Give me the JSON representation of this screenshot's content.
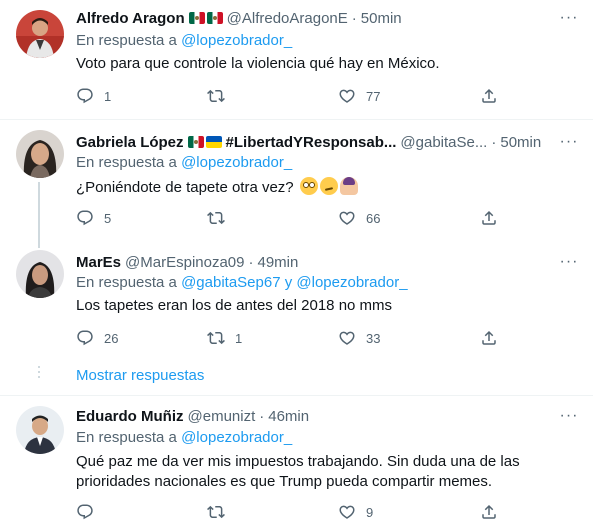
{
  "reply_prefix": "En respuesta a",
  "show_more_replies": "Mostrar respuestas",
  "colors": {
    "link": "#1d9bf0",
    "secondary": "#536471",
    "text": "#0f1419",
    "thread_line": "#cfd9de"
  },
  "tweets": [
    {
      "name": "Alfredo Aragon",
      "flags": [
        "mx-flag",
        "mx-flag"
      ],
      "handle": "@AlfredoAragonE",
      "time": "50min",
      "reply_to": [
        "@lopezobrador_"
      ],
      "text": "Voto para que controle la violencia qué hay en México.",
      "replies": "1",
      "retweets": "",
      "likes": "77"
    },
    {
      "name": "Gabriela López",
      "flags": [
        "mx-flag",
        "ua-flag"
      ],
      "name_suffix": "#LibertadYResponsab...",
      "handle": "@gabitaSe...",
      "time": "50min",
      "reply_to": [
        "@lopezobrador_"
      ],
      "text": "¿Poniéndote de tapete otra vez?",
      "emojis": [
        "face-with-rolling-eyes",
        "smirking-face",
        "woman-facepalming"
      ],
      "replies": "5",
      "retweets": "",
      "likes": "66"
    },
    {
      "name": "MarEs",
      "handle": "@MarEspinoza09",
      "time": "49min",
      "reply_to": [
        "@gabitaSep67",
        "@lopezobrador_"
      ],
      "reply_joiner": "y",
      "text": "Los tapetes eran los de antes del 2018 no mms",
      "replies": "26",
      "retweets": "1",
      "likes": "33"
    },
    {
      "name": "Eduardo Muñiz",
      "handle": "@emunizt",
      "time": "46min",
      "reply_to": [
        "@lopezobrador_"
      ],
      "text": "Qué paz me da ver mis impuestos trabajando. Sin duda una de las prioridades nacionales es que Trump pueda compartir memes.",
      "replies": "",
      "retweets": "",
      "likes": "9"
    }
  ]
}
